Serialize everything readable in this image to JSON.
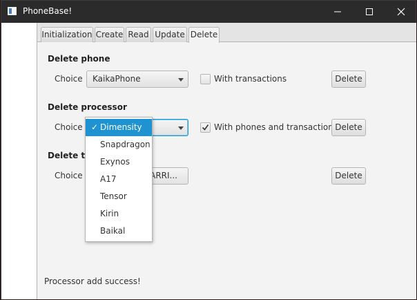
{
  "window": {
    "title": "PhoneBase!"
  },
  "tabs": [
    {
      "label": "Initialization"
    },
    {
      "label": "Create"
    },
    {
      "label": "Read"
    },
    {
      "label": "Update"
    },
    {
      "label": "Delete",
      "active": true
    }
  ],
  "delete_phone": {
    "title": "Delete phone",
    "choice_label": "Choice",
    "selected": "KaikaPhone",
    "checkbox_label": "With transactions",
    "checkbox_checked": false,
    "button": "Delete"
  },
  "delete_processor": {
    "title": "Delete processor",
    "choice_label": "Choice",
    "selected": "Dimensity",
    "checkbox_label": "With phones and transaction",
    "checkbox_checked": true,
    "button": "Delete",
    "options": [
      "Dimensity",
      "Snapdragon",
      "Exynos",
      "A17",
      "Tensor",
      "Kirin",
      "Baikal"
    ],
    "check_mark": "✓"
  },
  "delete_transaction": {
    "title_visible": "Delete tra",
    "choice_label": "Choice",
    "selected_partial": "_ARRI...",
    "button": "Delete"
  },
  "status": "Processor add success!",
  "colors": {
    "accent": "#1f93d1",
    "titlebar": "#2b2b2b"
  }
}
